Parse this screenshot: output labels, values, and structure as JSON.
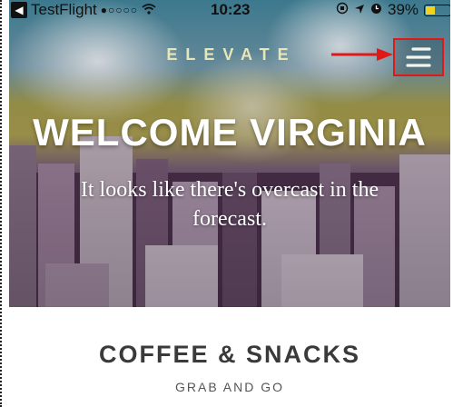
{
  "status_bar": {
    "back_app": "TestFlight",
    "signal": "●○○○○",
    "time": "10:23",
    "battery_percent": "39%",
    "battery_level": 0.39,
    "battery_color": "#f2d21c"
  },
  "header": {
    "logo": "ELEVATE",
    "menu_icon": "hamburger-icon",
    "highlight_color": "#e01818"
  },
  "hero": {
    "title": "WELCOME VIRGINIA",
    "message": "It looks like there's overcast in the forecast."
  },
  "section": {
    "title": "COFFEE & SNACKS",
    "subtitle": "GRAB AND GO"
  }
}
